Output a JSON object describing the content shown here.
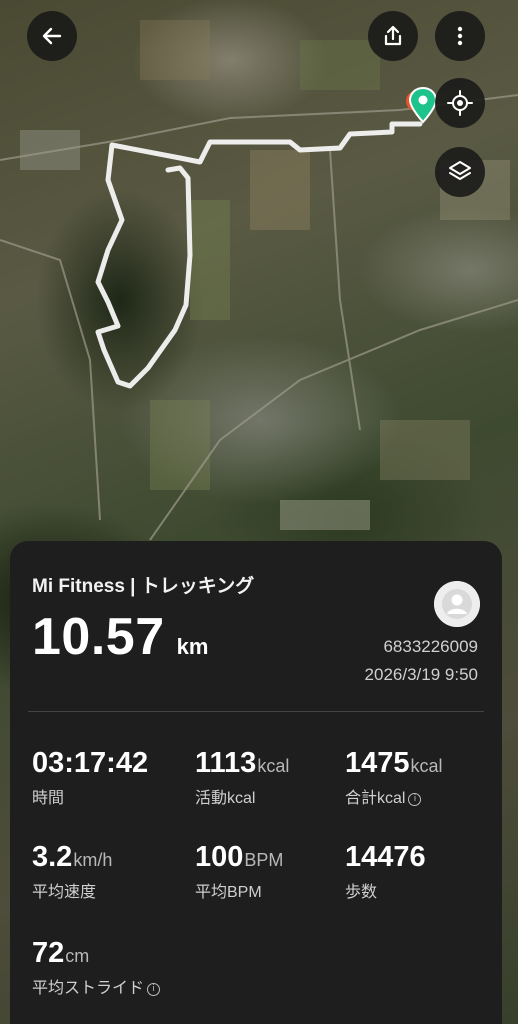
{
  "header": {
    "back_icon": "arrow-left-icon",
    "share_icon": "share-icon",
    "more_icon": "more-vertical-icon",
    "locate_icon": "crosshair-icon",
    "layers_icon": "layers-icon"
  },
  "map": {
    "route_color": "#f5f5f5",
    "pin_color": "#1ec38c",
    "start_marker_color": "#e8552d"
  },
  "summary": {
    "title": "Mi Fitness | トレッキング",
    "distance_value": "10.57",
    "distance_unit": "km",
    "user_id": "6833226009",
    "datetime": "2026/3/19 9:50"
  },
  "stats": [
    {
      "value": "03:17:42",
      "unit": "",
      "label": "時間",
      "info": false
    },
    {
      "value": "1113",
      "unit": "kcal",
      "label": "活動kcal",
      "info": false
    },
    {
      "value": "1475",
      "unit": "kcal",
      "label": "合計kcal",
      "info": true
    },
    {
      "value": "3.2",
      "unit": "km/h",
      "label": "平均速度",
      "info": false
    },
    {
      "value": "100",
      "unit": "BPM",
      "label": "平均BPM",
      "info": false
    },
    {
      "value": "14476",
      "unit": "",
      "label": "歩数",
      "info": false
    },
    {
      "value": "72",
      "unit": "cm",
      "label": "平均ストライド",
      "info": true
    }
  ],
  "info_glyph": "i"
}
